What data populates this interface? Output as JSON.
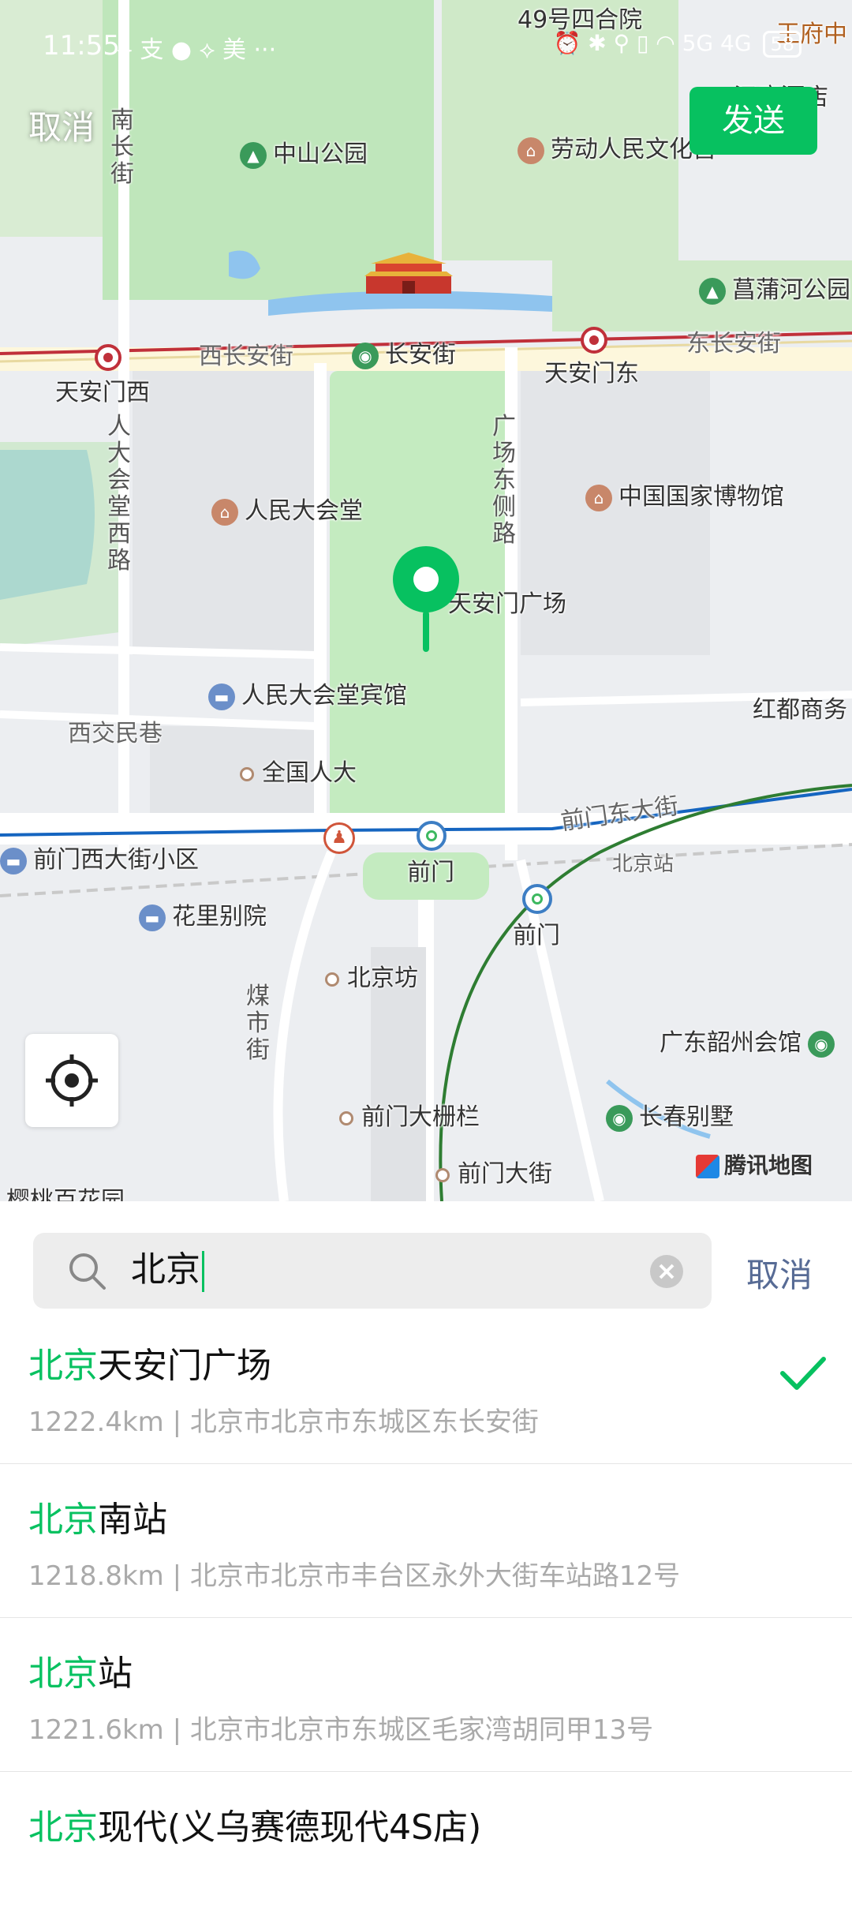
{
  "status_bar": {
    "time": "11:55",
    "app_icons": "⟡ 支 ● ⟡ 美 ···",
    "right_icons": "⏰ ✱ ⚲ ▯ ◠ 5G 4G",
    "battery": "58"
  },
  "header": {
    "cancel_label": "取消",
    "send_label": "发送"
  },
  "map": {
    "attribution": "腾讯地图",
    "labels": {
      "sihe": "49号四合院",
      "wangfu": "王府中",
      "hotel": "汉庭酒店",
      "zhongshan": "中山公园",
      "laodong": "劳动人民文化宫",
      "changpu": "菖蒲河公园",
      "nanchang": "南长街",
      "xichangan": "西长安街",
      "changanjie": "长安街",
      "dongchangan": "东长安街",
      "tiananmenxi": "天安门西",
      "tiananmendong": "天安门东",
      "renda_xilu": "人大会堂西路",
      "guangchang_dongce": "广场东侧路",
      "renmin_dahuitang": "人民大会堂",
      "guojia_bowuguan": "中国国家博物馆",
      "tiananmen_guangchang": "天安门广场",
      "binguan": "人民大会堂宾馆",
      "hongdu": "红都商务",
      "xijiaominxiang": "西交民巷",
      "quanguorenda": "全国人大",
      "qianmen_dongdajie": "前门东大街",
      "qianmen_xidajie": "前门西大街小区",
      "qianmen1": "前门",
      "beijingzhan_road": "北京站",
      "qianmen2": "前门",
      "huali": "花里别院",
      "beijingfang": "北京坊",
      "meishijie": "煤市街",
      "guangdong": "广东韶州会馆",
      "dashilan": "前门大栅栏",
      "changchun": "长春别墅",
      "qianmen_dajie": "前门大街",
      "yingtao": "樱桃百花园"
    }
  },
  "search": {
    "query": "北京",
    "cancel_label": "取消"
  },
  "results": [
    {
      "highlight": "北京",
      "rest": "天安门广场",
      "sub": "1222.4km | 北京市北京市东城区东长安街",
      "selected": true
    },
    {
      "highlight": "北京",
      "rest": "南站",
      "sub": "1218.8km | 北京市北京市丰台区永外大街车站路12号",
      "selected": false
    },
    {
      "highlight": "北京",
      "rest": "站",
      "sub": "1221.6km | 北京市北京市东城区毛家湾胡同甲13号",
      "selected": false
    },
    {
      "highlight": "北京",
      "rest": "现代(义乌赛德现代4S店)",
      "sub": "",
      "selected": false
    }
  ],
  "colors": {
    "accent": "#07c160",
    "link": "#576b95",
    "park": "#c4ebc0",
    "water": "#8fc4ee"
  }
}
